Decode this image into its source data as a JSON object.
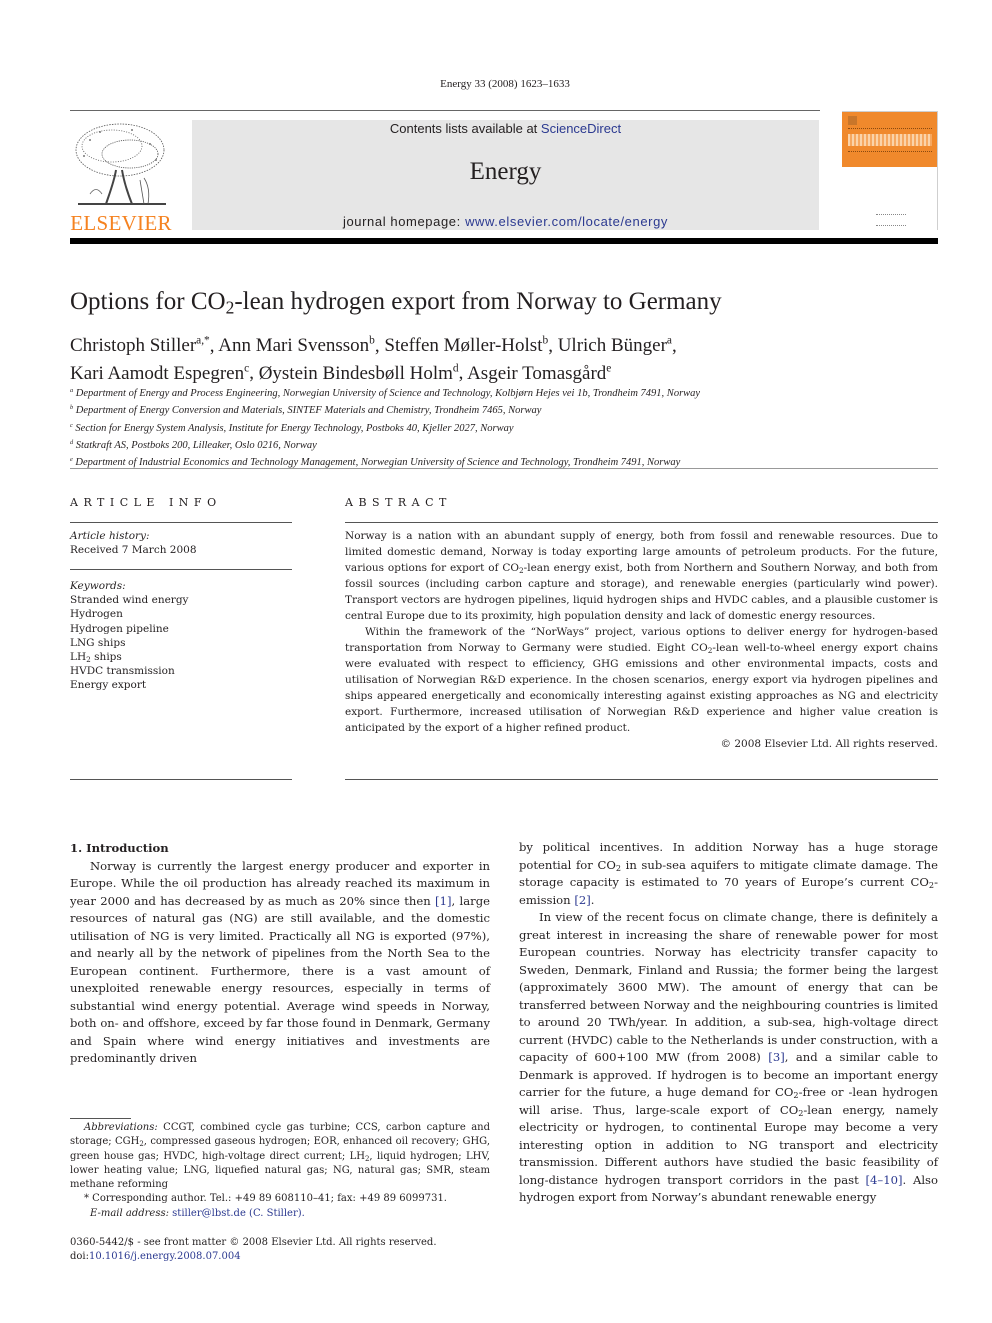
{
  "header": {
    "journal_reference": "Energy 33 (2008) 1623–1633",
    "contents_prefix": "Contents lists available at ",
    "contents_link": "ScienceDirect",
    "journal_name": "Energy",
    "homepage_prefix": "journal homepage: ",
    "homepage_link": "www.elsevier.com/locate/energy",
    "publisher_logo_text": "ELSEVIER",
    "publisher_logo_icon": "elsevier-tree-icon",
    "cover_image": "journal-cover-thumbnail",
    "colors": {
      "publisher_orange": "#f58220",
      "link_blue": "#2b3990",
      "banner_gray": "#e6e6e6",
      "cover_orange": "#f0892c"
    }
  },
  "article": {
    "title_pre": "Options for CO",
    "title_sub": "2",
    "title_post": "-lean hydrogen export from Norway to Germany",
    "authors": [
      {
        "name": "Christoph Stiller",
        "aff": "a,*",
        "sep": ", "
      },
      {
        "name": "Ann Mari Svensson",
        "aff": "b",
        "sep": ", "
      },
      {
        "name": "Steffen Møller-Holst",
        "aff": "b",
        "sep": ", "
      },
      {
        "name": "Ulrich Bünger",
        "aff": "a",
        "sep": ","
      },
      {
        "name": "Kari Aamodt Espegren",
        "aff": "c",
        "sep": ", "
      },
      {
        "name": "Øystein Bindesbøll Holm",
        "aff": "d",
        "sep": ", "
      },
      {
        "name": "Asgeir Tomasgård",
        "aff": "e",
        "sep": ""
      }
    ],
    "affiliations": [
      {
        "key": "a",
        "text": "Department of Energy and Process Engineering, Norwegian University of Science and Technology, Kolbjørn Hejes vei 1b, Trondheim 7491, Norway"
      },
      {
        "key": "b",
        "text": "Department of Energy Conversion and Materials, SINTEF Materials and Chemistry, Trondheim 7465, Norway"
      },
      {
        "key": "c",
        "text": "Section for Energy System Analysis, Institute for Energy Technology, Postboks 40, Kjeller 2027, Norway"
      },
      {
        "key": "d",
        "text": "Statkraft AS, Postboks 200, Lilleaker, Oslo 0216, Norway"
      },
      {
        "key": "e",
        "text": "Department of Industrial Economics and Technology Management, Norwegian University of Science and Technology, Trondheim 7491, Norway"
      }
    ]
  },
  "article_info": {
    "heading": "ARTICLE INFO",
    "history_label": "Article history:",
    "received": "Received 7 March 2008",
    "keywords_label": "Keywords:",
    "keywords": [
      "Stranded wind energy",
      "Hydrogen",
      "Hydrogen pipeline",
      "LNG ships"
    ],
    "keyword_lh2_pre": "LH",
    "keyword_lh2_sub": "2",
    "keyword_lh2_post": " ships",
    "keywords_after": [
      "HVDC transmission",
      "Energy export"
    ]
  },
  "abstract": {
    "heading": "ABSTRACT",
    "p1_a": "Norway is a nation with an abundant supply of energy, both from fossil and renewable resources. Due to limited domestic demand, Norway is today exporting large amounts of petroleum products. For the future, various options for export of CO",
    "p1_b": "-lean energy exist, both from Northern and Southern Norway, and both from fossil sources (including carbon capture and storage), and renewable energies (particularly wind power). Transport vectors are hydrogen pipelines, liquid hydrogen ships and HVDC cables, and a plausible customer is central Europe due to its proximity, high population density and lack of domestic energy resources.",
    "p2_a": "Within the framework of the “NorWays” project, various options to deliver energy for hydrogen-based transportation from Norway to Germany were studied. Eight CO",
    "p2_b": "-lean well-to-wheel energy export chains were evaluated with respect to efficiency, GHG emissions and other environmental impacts, costs and utilisation of Norwegian R&D experience. In the chosen scenarios, energy export via hydrogen pipelines and ships appeared energetically and economically interesting against existing approaches as NG and electricity export. Furthermore, increased utilisation of Norwegian R&D experience and higher value creation is anticipated by the export of a higher refined product.",
    "sub2": "2",
    "copyright": "© 2008 Elsevier Ltd. All rights reserved."
  },
  "body": {
    "section_title": "1.  Introduction",
    "c1_a": "Norway is currently the largest energy producer and exporter in Europe. While the oil production has already reached its maximum in year 2000 and has decreased by as much as 20% since then ",
    "ref1": "[1]",
    "c1_b": ", large resources of natural gas (NG) are still available, and the domestic utilisation of NG is very limited. Practically all NG is exported (97%), and nearly all by the network of pipelines from the North Sea to the European continent. Furthermore, there is a vast amount of unexploited renewable energy resources, especially in terms of substantial wind energy potential. Average wind speeds in Norway, both on- and offshore, exceed by far those found in Denmark, Germany and Spain where wind energy initiatives and investments are predominantly driven",
    "c2_a": "by political incentives. In addition Norway has a huge storage potential for CO",
    "c2_b": " in sub-sea aquifers to mitigate climate damage. The storage capacity is estimated to 70 years of Europe’s current CO",
    "c2_c": "-emission ",
    "ref2": "[2]",
    "c2_d": ".",
    "c3_a": "In view of the recent focus on climate change, there is definitely a great interest in increasing the share of renewable power for most European countries. Norway has electricity transfer capacity to Sweden, Denmark, Finland and Russia; the former being the largest (approximately 3600 MW). The amount of energy that can be transferred between Norway and the neighbouring countries is limited to around 20 TWh/year. In addition, a sub-sea, high-voltage direct current (HVDC) cable to the Netherlands is under construction, with a capacity of 600+100 MW (from 2008) ",
    "ref3": "[3]",
    "c3_b": ", and a similar cable to Denmark is approved. If hydrogen is to become an important energy carrier for the future, a huge demand for CO",
    "c3_c": "-free or -lean hydrogen will arise. Thus, large-scale export of CO",
    "c3_d": "-lean energy, namely electricity or hydrogen, to continental Europe may become a very interesting option in addition to NG transport and electricity transmission. Different authors have studied the basic feasibility of long-distance hydrogen transport corridors in the past ",
    "ref4": "[4–10]",
    "c3_e": ". Also hydrogen export from Norway’s abundant renewable energy",
    "sub2": "2"
  },
  "footnotes": {
    "abbr_label": "Abbreviations:",
    "abbr_a": " CCGT, combined cycle gas turbine; CCS, carbon capture and storage; CGH",
    "abbr_b": ", compressed gaseous hydrogen; EOR, enhanced oil recovery; GHG, green house gas; HVDC, high-voltage direct current; LH",
    "abbr_c": ", liquid hydrogen; LHV, lower heating value; LNG, liquefied natural gas; NG, natural gas; SMR, steam methane reforming",
    "sub2": "2",
    "corresponding": "* Corresponding author. Tel.: +49 89 608110–41; fax: +49 89 6099731.",
    "email_label": "E-mail address: ",
    "email": "stiller@lbst.de (C. Stiller).",
    "front_matter": "0360-5442/$ - see front matter © 2008 Elsevier Ltd. All rights reserved.",
    "doi_label": "doi:",
    "doi": "10.1016/j.energy.2008.07.004"
  }
}
